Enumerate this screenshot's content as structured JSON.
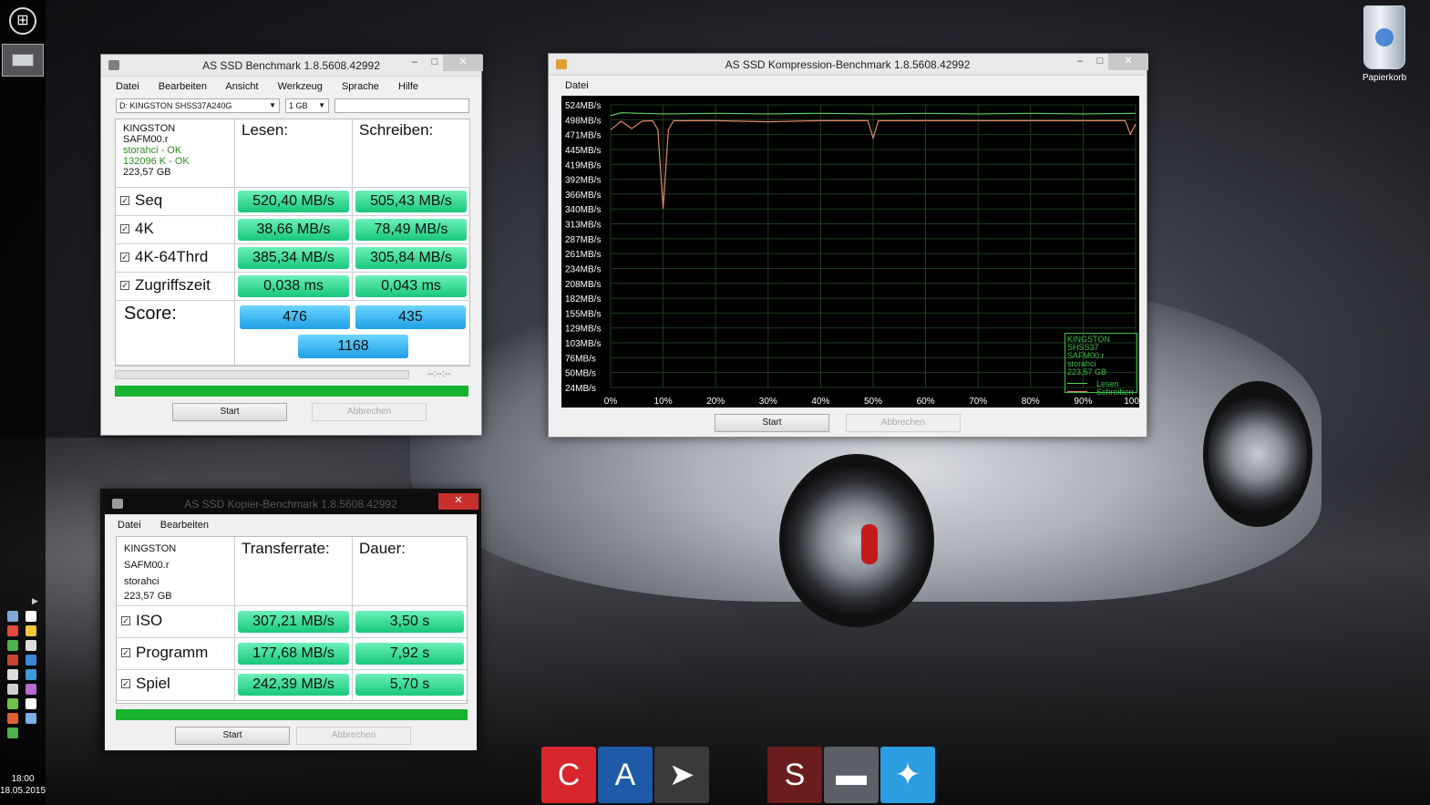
{
  "desktop": {
    "recycle_label": "Papierkorb",
    "clock_time": "18:00",
    "clock_date": "18.05.2015",
    "tray_icon_colors": [
      "#7fa8d9",
      "#ffffff",
      "#e24a3b",
      "#f2c73c",
      "#4bb24c",
      "#dddddd",
      "#c94433",
      "#3a87d6",
      "#dddddd",
      "#3e9ad8",
      "#cfcfcf",
      "#b46bd3",
      "#6cc24a",
      "#ffffff",
      "#e06030",
      "#7cb0e6",
      "#4caf50"
    ]
  },
  "bench": {
    "title": "AS SSD Benchmark 1.8.5608.42992",
    "menu": [
      "Datei",
      "Bearbeiten",
      "Ansicht",
      "Werkzeug",
      "Sprache",
      "Hilfe"
    ],
    "drive_select": "D: KINGSTON SHSS37A240G",
    "size_select": "1 GB",
    "info": [
      "KINGSTON",
      "SAFM00.r",
      "storahci - OK",
      "132096 K - OK",
      "223,57 GB"
    ],
    "col_read": "Lesen:",
    "col_write": "Schreiben:",
    "rows": [
      {
        "label": "Seq",
        "read": "520,40 MB/s",
        "write": "505,43 MB/s"
      },
      {
        "label": "4K",
        "read": "38,66 MB/s",
        "write": "78,49 MB/s"
      },
      {
        "label": "4K-64Thrd",
        "read": "385,34 MB/s",
        "write": "305,84 MB/s"
      },
      {
        "label": "Zugriffszeit",
        "read": "0,038 ms",
        "write": "0,043 ms"
      }
    ],
    "score_label": "Score:",
    "score_read": "476",
    "score_write": "435",
    "score_total": "1168",
    "time_readout": "--:--:--",
    "start_label": "Start",
    "abort_label": "Abbrechen",
    "progress": 1.0
  },
  "compress": {
    "title": "AS SSD Kompression-Benchmark 1.8.5608.42992",
    "menu": [
      "Datei"
    ],
    "start_label": "Start",
    "abort_label": "Abbrechen",
    "legend_lines": [
      "KINGSTON SHSS37",
      "SAFM00.r",
      "storahci",
      "223,57 GB"
    ],
    "legend_read": "Lesen",
    "legend_write": "Schreiben"
  },
  "chart_data": {
    "type": "line",
    "y_ticks": [
      "524MB/s",
      "498MB/s",
      "471MB/s",
      "445MB/s",
      "419MB/s",
      "392MB/s",
      "366MB/s",
      "340MB/s",
      "313MB/s",
      "287MB/s",
      "261MB/s",
      "234MB/s",
      "208MB/s",
      "182MB/s",
      "155MB/s",
      "129MB/s",
      "103MB/s",
      "76MB/s",
      "50MB/s",
      "24MB/s"
    ],
    "x_ticks": [
      "0%",
      "10%",
      "20%",
      "30%",
      "40%",
      "50%",
      "60%",
      "70%",
      "80%",
      "90%",
      "100%"
    ],
    "ylim": [
      24,
      524
    ],
    "xlim": [
      0,
      100
    ],
    "grid": true,
    "legend": "bottom-right",
    "series": [
      {
        "name": "Lesen",
        "color": "#5ad65a",
        "x": [
          0,
          2,
          10,
          20,
          30,
          40,
          50,
          60,
          70,
          80,
          90,
          100
        ],
        "y": [
          505,
          510,
          508,
          509,
          508,
          509,
          508,
          509,
          508,
          509,
          508,
          509
        ]
      },
      {
        "name": "Schreiben",
        "color": "#e0866b",
        "x": [
          0,
          2,
          4,
          6,
          8,
          9,
          10,
          11,
          12,
          20,
          30,
          40,
          49,
          50,
          51,
          52,
          60,
          70,
          80,
          90,
          98,
          99,
          100
        ],
        "y": [
          480,
          495,
          482,
          495,
          496,
          480,
          340,
          480,
          496,
          496,
          494,
          496,
          496,
          465,
          496,
          496,
          496,
          496,
          496,
          496,
          496,
          472,
          490
        ]
      }
    ]
  },
  "copy": {
    "title": "AS SSD Kopier-Benchmark 1.8.5608.42992",
    "menu": [
      "Datei",
      "Bearbeiten"
    ],
    "info": [
      "KINGSTON",
      "SAFM00.r",
      "storahci",
      "223,57 GB"
    ],
    "col_rate": "Transferrate:",
    "col_time": "Dauer:",
    "rows": [
      {
        "label": "ISO",
        "rate": "307,21 MB/s",
        "time": "3,50 s"
      },
      {
        "label": "Programm",
        "rate": "177,68 MB/s",
        "time": "7,92 s"
      },
      {
        "label": "Spiel",
        "rate": "242,39 MB/s",
        "time": "5,70 s"
      }
    ],
    "start_label": "Start",
    "abort_label": "Abbrechen",
    "progress": 1.0
  },
  "dock": {
    "items": [
      {
        "name": "ccleaner-icon",
        "color": "#d7262c",
        "glyph": "C"
      },
      {
        "name": "app-a-icon",
        "color": "#1f5aa8",
        "glyph": "A"
      },
      {
        "name": "arrow-app-icon",
        "color": "#3a3a3a",
        "glyph": "➤"
      },
      {
        "name": "sram-icon",
        "color": "#6b1c1c",
        "glyph": "S"
      },
      {
        "name": "drive-tool-icon",
        "color": "#5c5f66",
        "glyph": "▬"
      },
      {
        "name": "colorful-app-icon",
        "color": "#2c9de0",
        "glyph": "✦"
      }
    ]
  }
}
